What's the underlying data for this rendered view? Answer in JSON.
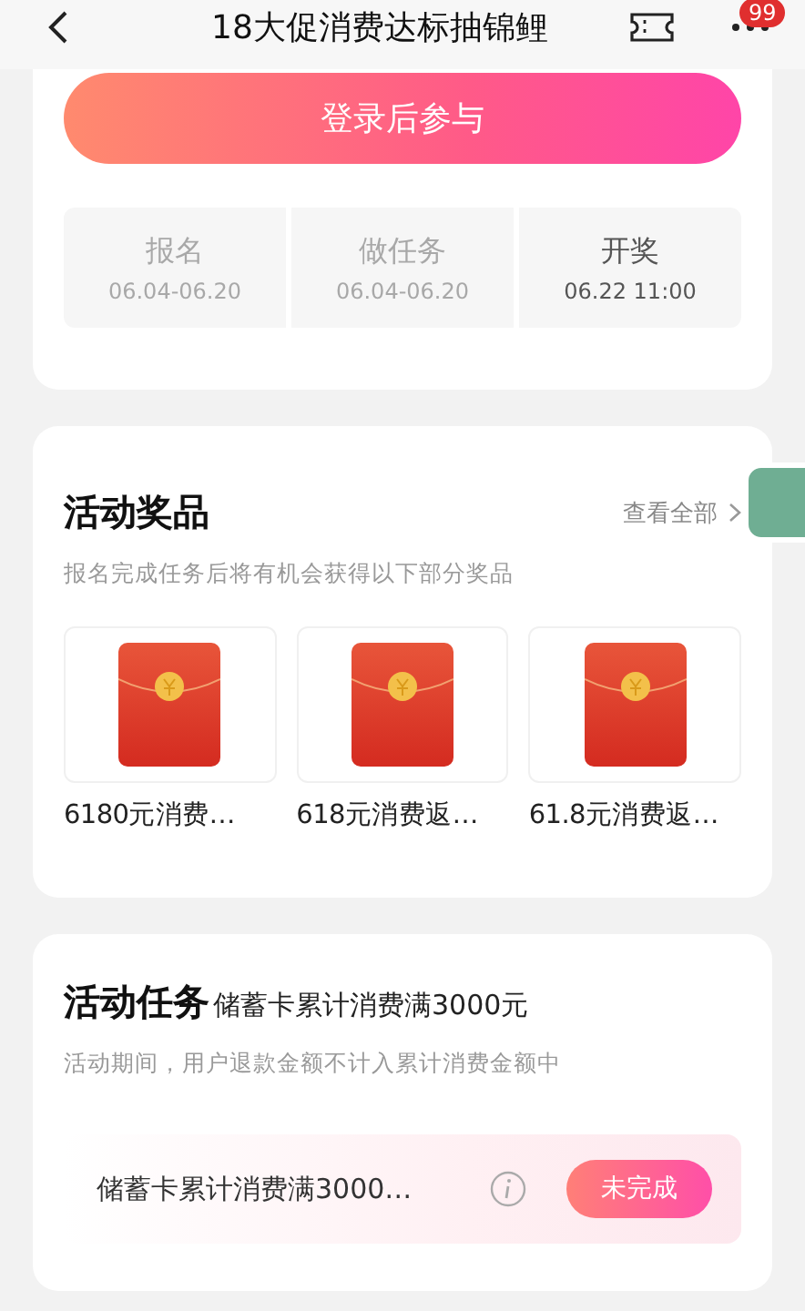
{
  "header": {
    "title": "18大促消费达标抽锦鲤",
    "badge": "99"
  },
  "join_button": "登录后参与",
  "steps": [
    {
      "label": "报名",
      "date": "06.04-06.20",
      "active": false
    },
    {
      "label": "做任务",
      "date": "06.04-06.20",
      "active": false
    },
    {
      "label": "开奖",
      "date": "06.22 11:00",
      "active": true
    }
  ],
  "prizes": {
    "title": "活动奖品",
    "view_all": "查看全部",
    "subtitle": "报名完成任务后将有机会获得以下部分奖品",
    "items": [
      {
        "name": "6180元消费…"
      },
      {
        "name": "618元消费返…"
      },
      {
        "name": "61.8元消费返…"
      }
    ]
  },
  "tasks": {
    "title": "活动任务",
    "condition": "储蓄卡累计消费满3000元",
    "note": "活动期间，用户退款金额不计入累计消费金额中",
    "items": [
      {
        "name": "储蓄卡累计消费满3000…",
        "status": "未完成",
        "done": false
      }
    ]
  }
}
